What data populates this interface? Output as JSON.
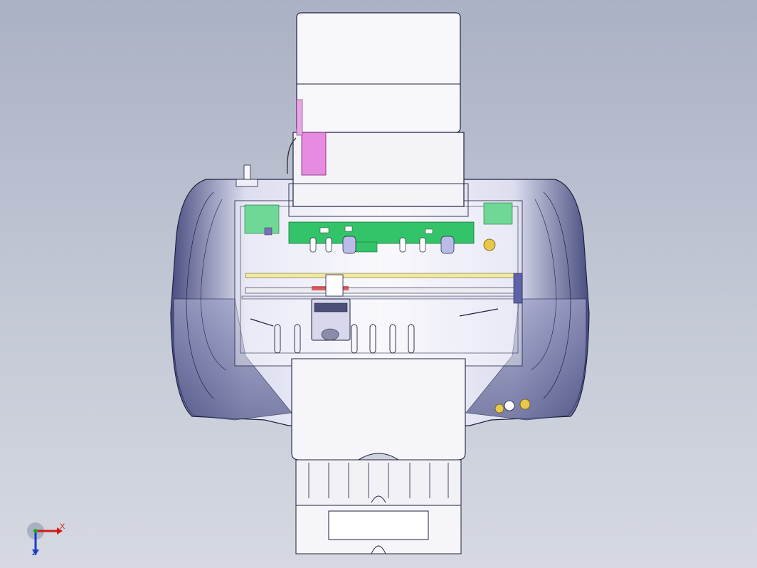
{
  "scene": {
    "model": "printer-assembly",
    "view": "top",
    "display_mode": "wireframe-shaded-transparent",
    "colors": {
      "background_top": "#aab1c4",
      "background_bottom": "#d6d9e1",
      "body_shell": "#6a6f9c",
      "body_highlight": "#e9eaf5",
      "paper_tray": "#f4f4f8",
      "circuit_board": "#33c46a",
      "label_pink": "#e58be0",
      "carriage": "#4c4f78",
      "roller": "#b9bbe8",
      "gear_gold": "#e8c84a",
      "rail_yellow": "#f2e8a0"
    }
  },
  "triad": {
    "x_label": "X",
    "z_label": "Z",
    "x_color": "#d21919",
    "y_color": "#1aa81a",
    "z_color": "#1a3cc8"
  }
}
